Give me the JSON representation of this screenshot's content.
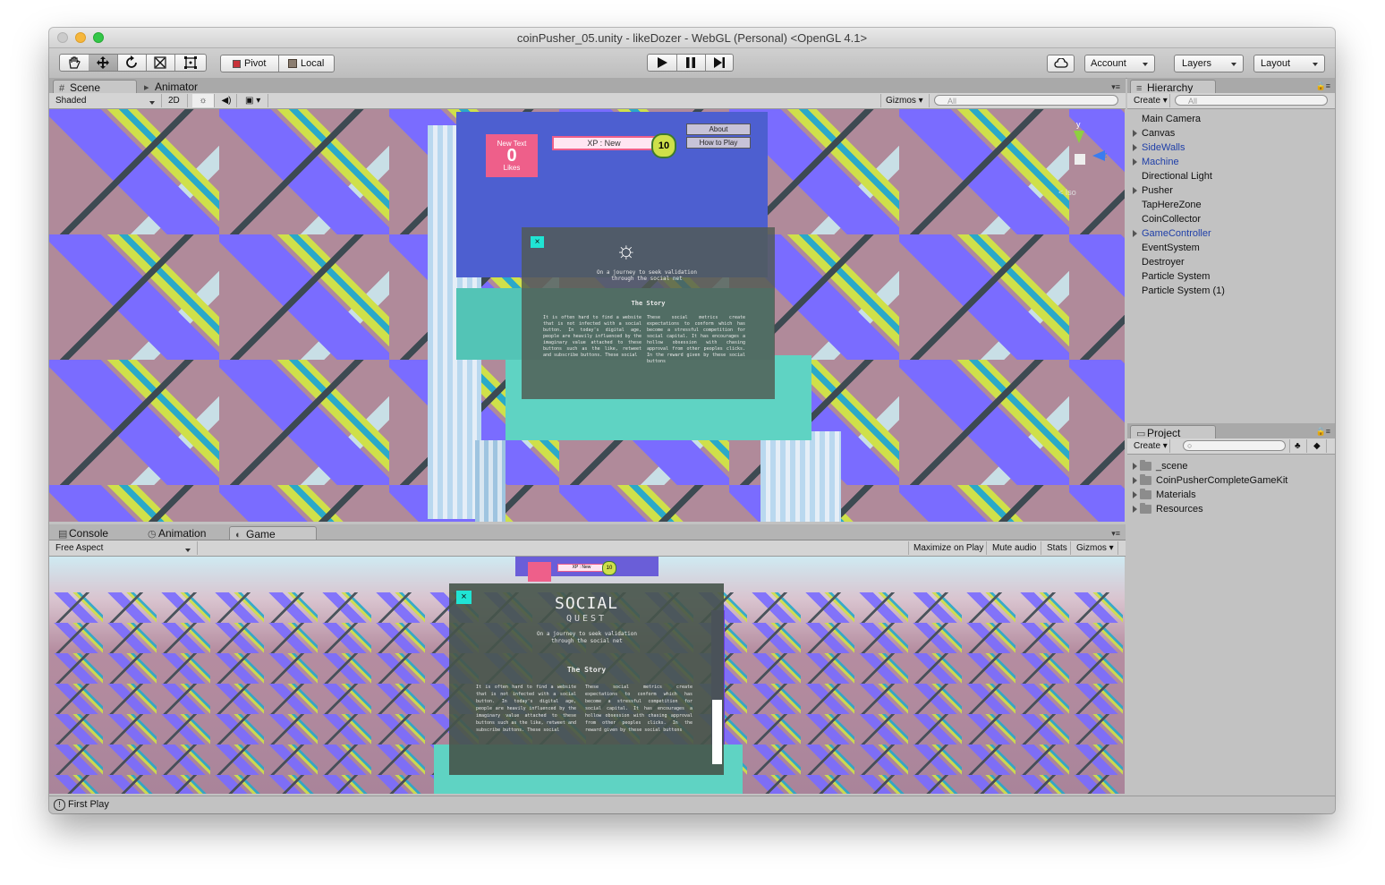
{
  "window": {
    "title": "coinPusher_05.unity - likeDozer - WebGL (Personal) <OpenGL 4.1>"
  },
  "toolbar": {
    "pivot_label": "Pivot",
    "local_label": "Local",
    "account_label": "Account",
    "layers_label": "Layers",
    "layout_label": "Layout"
  },
  "scene_panel": {
    "tabs": [
      {
        "label": "Scene"
      },
      {
        "label": "Animator"
      }
    ],
    "shading_mode": "Shaded",
    "mode_2d": "2D",
    "gizmos_label": "Gizmos",
    "search_placeholder": "All"
  },
  "game_panel": {
    "tabs": [
      {
        "label": "Console"
      },
      {
        "label": "Animation"
      },
      {
        "label": "Game"
      }
    ],
    "aspect": "Free Aspect",
    "maximize_label": "Maximize on Play",
    "mute_label": "Mute audio",
    "stats_label": "Stats",
    "gizmos_label": "Gizmos"
  },
  "hierarchy": {
    "tab_label": "Hierarchy",
    "create_label": "Create",
    "search_placeholder": "All",
    "items": [
      {
        "label": "Main Camera",
        "expandable": false,
        "prefab": false
      },
      {
        "label": "Canvas",
        "expandable": true,
        "prefab": false
      },
      {
        "label": "SideWalls",
        "expandable": true,
        "prefab": true
      },
      {
        "label": "Machine",
        "expandable": true,
        "prefab": true
      },
      {
        "label": "Directional Light",
        "expandable": false,
        "prefab": false
      },
      {
        "label": "Pusher",
        "expandable": true,
        "prefab": false
      },
      {
        "label": "TapHereZone",
        "expandable": false,
        "prefab": false
      },
      {
        "label": "CoinCollector",
        "expandable": false,
        "prefab": false
      },
      {
        "label": "GameController",
        "expandable": true,
        "prefab": true
      },
      {
        "label": "EventSystem",
        "expandable": false,
        "prefab": false
      },
      {
        "label": "Destroyer",
        "expandable": false,
        "prefab": false
      },
      {
        "label": "Particle System",
        "expandable": false,
        "prefab": false
      },
      {
        "label": "Particle System (1)",
        "expandable": false,
        "prefab": false
      }
    ]
  },
  "project": {
    "tab_label": "Project",
    "create_label": "Create",
    "folders": [
      {
        "label": "_scene"
      },
      {
        "label": "CoinPusherCompleteGameKit"
      },
      {
        "label": "Materials"
      },
      {
        "label": "Resources"
      }
    ]
  },
  "game_ui": {
    "counter_label": "New Text",
    "counter_value": "0",
    "likes_label": "Likes",
    "xp_label": "XP : New",
    "level": "10",
    "about_label": "About",
    "howto_label": "How to Play",
    "close_symbol": "×",
    "logo_line1": "SOCIAL",
    "logo_line2": "QUEST",
    "tagline": "On a journey to seek validation through the social net",
    "story_heading": "The Story",
    "story_left": "It is often hard to find a website that is not infected with a social button. In today's digital age, people are heavily influenced by the imaginary value attached to these buttons such as the like, retweet and subscribe buttons. These social",
    "story_right": "These social metrics create expectations to conform which has become a stressful competition for social capital. It has encourages a hollow obsession with chasing approval from other peoples clicks. In the reward given by these social buttons"
  },
  "gizmo": {
    "y_label": "y",
    "z_label": "z",
    "persp_label": "< Iso"
  },
  "status": {
    "message": "First Play"
  },
  "colors": {
    "purple": "#7a6cff",
    "lime": "#cfe04a",
    "mauve": "#b08a9a",
    "teal": "#5fd3c3",
    "pink": "#ee5f8a"
  }
}
